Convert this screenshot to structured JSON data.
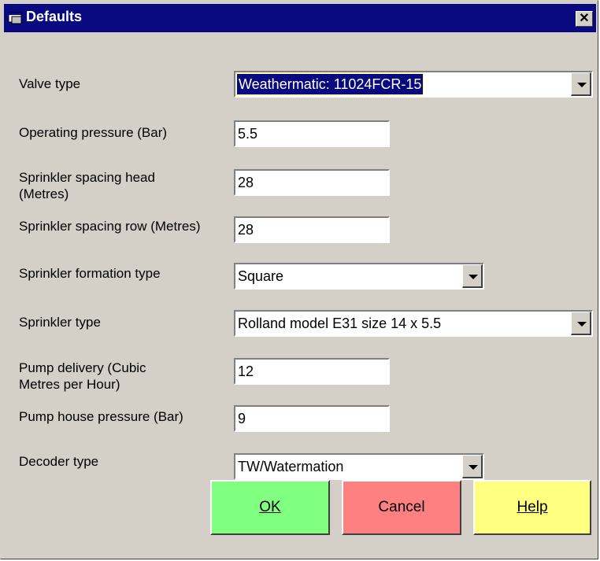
{
  "window": {
    "title": "Defaults",
    "close_glyph": "✕"
  },
  "fields": {
    "valve_type": {
      "label": "Valve type",
      "value": "Weathermatic: 11024FCR-15"
    },
    "operating_pressure": {
      "label": "Operating pressure (Bar)",
      "value": "5.5"
    },
    "spacing_head": {
      "label": "Sprinkler spacing head (Metres)",
      "value": "28"
    },
    "spacing_row": {
      "label": "Sprinkler spacing row (Metres)",
      "value": "28"
    },
    "formation_type": {
      "label": "Sprinkler formation type",
      "value": "Square"
    },
    "sprinkler_type": {
      "label": "Sprinkler type",
      "value": "Rolland model E31 size 14 x 5.5"
    },
    "pump_delivery": {
      "label": "Pump delivery (Cubic Metres per Hour)",
      "value": "12"
    },
    "pump_house_pressure": {
      "label": "Pump house pressure (Bar)",
      "value": "9"
    },
    "decoder_type": {
      "label": "Decoder type",
      "value": "TW/Watermation"
    }
  },
  "buttons": {
    "ok": {
      "label": "OK",
      "color": "#80ff80"
    },
    "cancel": {
      "label": "Cancel",
      "color": "#ff8080"
    },
    "help": {
      "label": "Help",
      "color": "#ffff80"
    }
  }
}
